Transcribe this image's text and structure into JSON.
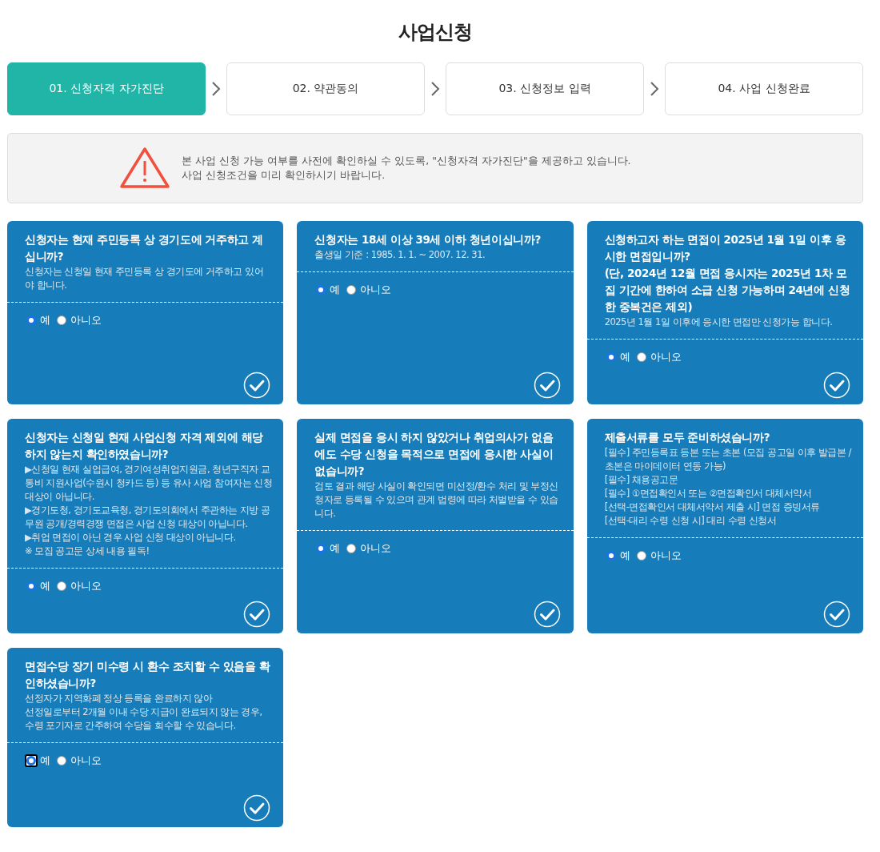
{
  "page_title": "사업신청",
  "steps": [
    {
      "label": "01. 신청자격 자가진단",
      "selected": true
    },
    {
      "label": "02. 약관동의",
      "selected": false
    },
    {
      "label": "03. 신청정보 입력",
      "selected": false
    },
    {
      "label": "04. 사업 신청완료",
      "selected": false
    }
  ],
  "notice": {
    "lines": [
      "본 사업 신청 가능 여부를 사전에 확인하실 수 있도록, \"신청자격 자가진단\"을 제공하고 있습니다.",
      "사업 신청조건을 미리 확인하시기 바랍니다."
    ]
  },
  "questions": [
    {
      "question": [
        "신청자는 현재 주민등록 상 경기도에 거주하고 계십니까?"
      ],
      "notes": [
        "신청자는 신청일 현재 주민등록 상 경기도에 거주하고 있어야 합니다."
      ],
      "options": [
        {
          "label": "예",
          "selected": true,
          "focused": false
        },
        {
          "label": "아니오",
          "selected": false,
          "focused": false
        }
      ]
    },
    {
      "question": [
        "신청자는 18세 이상 39세 이하 청년이십니까?"
      ],
      "notes": [
        "출생일 기준 : 1985. 1. 1. ~ 2007. 12. 31."
      ],
      "options": [
        {
          "label": "예",
          "selected": true,
          "focused": false
        },
        {
          "label": "아니오",
          "selected": false,
          "focused": false
        }
      ]
    },
    {
      "question": [
        "신청하고자 하는 면접이 2025년 1월 1일 이후 응시한 면접입니까?",
        "(단, 2024년 12월 면접 응시자는 2025년 1차 모집 기간에 한하여 소급 신청 가능하며 24년에 신청한 중복건은 제외)"
      ],
      "notes": [
        "2025년 1월 1일 이후에 응시한 면접만 신청가능 합니다."
      ],
      "options": [
        {
          "label": "예",
          "selected": true,
          "focused": false
        },
        {
          "label": "아니오",
          "selected": false,
          "focused": false
        }
      ]
    },
    {
      "question": [
        "신청자는 신청일 현재 사업신청 자격 제외에 해당하지 않는지 확인하였습니까?"
      ],
      "notes": [
        "▶신청일 현재 실업급여, 경기여성취업지원금, 청년구직자 교통비 지원사업(수원시 청카드 등) 등 유사 사업 참여자는 신청 대상이 아닙니다.",
        "▶경기도청, 경기도교육청, 경기도의회에서 주관하는 지방 공무원 공개/경력경쟁 면접은 사업 신청 대상이 아닙니다.",
        "▶취업 면접이 아닌 경우 사업 신청 대상이 아닙니다.",
        "※ 모집 공고문 상세 내용 필독!"
      ],
      "options": [
        {
          "label": "예",
          "selected": true,
          "focused": false
        },
        {
          "label": "아니오",
          "selected": false,
          "focused": false
        }
      ]
    },
    {
      "question": [
        "실제 면접을 응시 하지 않았거나 취업의사가 없음에도 수당 신청을 목적으로 면접에 응시한 사실이 없습니까?"
      ],
      "notes": [
        "검토 결과 해당 사실이 확인되면 미선정/환수 처리 및 부정신청자로 등록될 수 있으며 관계 법령에 따라 처벌받을 수 있습니다."
      ],
      "options": [
        {
          "label": "예",
          "selected": true,
          "focused": false
        },
        {
          "label": "아니오",
          "selected": false,
          "focused": false
        }
      ]
    },
    {
      "question": [
        "제출서류를 모두 준비하셨습니까?"
      ],
      "notes": [
        "[필수] 주민등록표 등본 또는 초본 (모집 공고일 이후 발급본 / 초본은 마이데이터 연동 가능)",
        "[필수] 채용공고문",
        "[필수] ①면접확인서 또는 ②면접확인서 대체서약서",
        "[선택-면접확인서 대체서약서 제출 시] 면접 증빙서류",
        "[선택-대리 수령 신청 시] 대리 수령 신청서"
      ],
      "options": [
        {
          "label": "예",
          "selected": true,
          "focused": false
        },
        {
          "label": "아니오",
          "selected": false,
          "focused": false
        }
      ]
    },
    {
      "question": [
        "면접수당 장기 미수령 시 환수 조치할 수 있음을 확인하셨습니까?"
      ],
      "notes": [
        "선정자가 지역화폐 정상 등록을 완료하지 않아",
        "선정일로부터 2개월 이내 수당 지급이 완료되지 않는 경우,",
        "수령 포기자로 간주하여 수당을 회수할 수 있습니다."
      ],
      "options": [
        {
          "label": "예",
          "selected": true,
          "focused": true
        },
        {
          "label": "아니오",
          "selected": false,
          "focused": false
        }
      ]
    }
  ]
}
